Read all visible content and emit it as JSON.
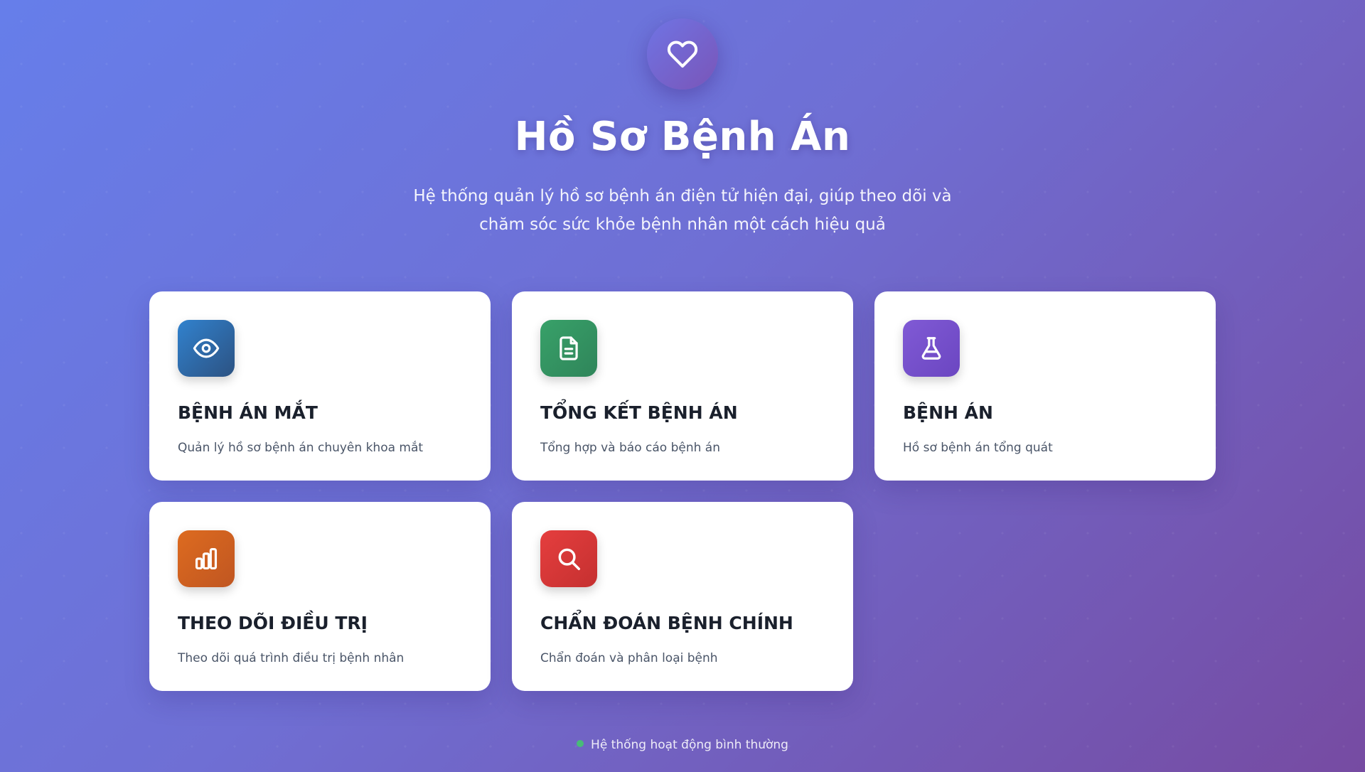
{
  "header": {
    "logo_icon": "heart-icon",
    "title": "Hồ Sơ Bệnh Án",
    "subtitle_line1": "Hệ thống quản lý hồ sơ bệnh án điện tử hiện đại, giúp theo dõi và",
    "subtitle_line2": "chăm sóc sức khỏe bệnh nhân một cách hiệu quả"
  },
  "cards": [
    {
      "title": "BỆNH ÁN MẮT",
      "description": "Quản lý hồ sơ bệnh án chuyên khoa mắt",
      "icon": "eye-icon",
      "color_from": "#3182ce",
      "color_to": "#2c5282"
    },
    {
      "title": "TỔNG KẾT BỆNH ÁN",
      "description": "Tổng hợp và báo cáo bệnh án",
      "icon": "document-icon",
      "color_from": "#38a169",
      "color_to": "#2f855a"
    },
    {
      "title": "BỆNH ÁN",
      "description": "Hồ sơ bệnh án tổng quát",
      "icon": "flask-icon",
      "color_from": "#805ad5",
      "color_to": "#6b46c1"
    },
    {
      "title": "THEO DÕI ĐIỀU TRỊ",
      "description": "Theo dõi quá trình điều trị bệnh nhân",
      "icon": "bar-chart-icon",
      "color_from": "#dd6b20",
      "color_to": "#c05621"
    },
    {
      "title": "CHẨN ĐOÁN BỆNH CHÍNH",
      "description": "Chẩn đoán và phân loại bệnh",
      "icon": "search-icon",
      "color_from": "#e53e3e",
      "color_to": "#c53030"
    }
  ],
  "status": {
    "text": "Hệ thống hoạt động bình thường",
    "dot_color": "#48bb78"
  }
}
